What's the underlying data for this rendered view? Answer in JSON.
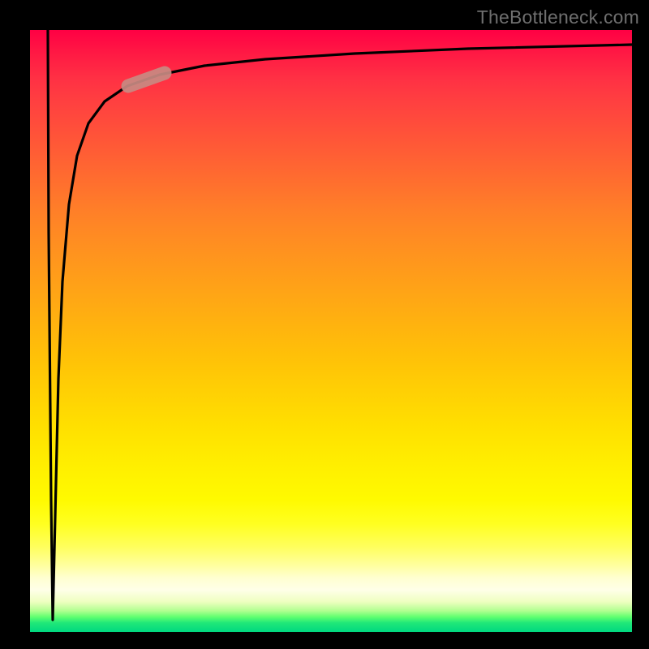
{
  "watermark": "TheBottleneck.com",
  "colors": {
    "curve": "#000000",
    "marker": "#c88a82",
    "gradient_top": "#ff0044",
    "gradient_mid": "#ffff20",
    "gradient_bottom": "#00d880",
    "frame": "#000000"
  },
  "chart_data": {
    "type": "line",
    "title": "",
    "xlabel": "",
    "ylabel": "",
    "xlim": [
      0,
      100
    ],
    "ylim": [
      0,
      100
    ],
    "legend_position": "none",
    "grid": false,
    "annotations": [
      {
        "text": "TheBottleneck.com",
        "position": "top-right"
      }
    ],
    "series": [
      {
        "name": "bottleneck-curve",
        "color": "#000000",
        "points": [
          {
            "x": 3.0,
            "y": 100.0
          },
          {
            "x": 3.2,
            "y": 50.0
          },
          {
            "x": 3.8,
            "y": 2.0
          },
          {
            "x": 4.2,
            "y": 20.0
          },
          {
            "x": 4.8,
            "y": 45.0
          },
          {
            "x": 5.5,
            "y": 60.0
          },
          {
            "x": 6.5,
            "y": 72.0
          },
          {
            "x": 8.0,
            "y": 80.0
          },
          {
            "x": 10.0,
            "y": 85.0
          },
          {
            "x": 13.0,
            "y": 88.5
          },
          {
            "x": 17.0,
            "y": 91.0
          },
          {
            "x": 22.0,
            "y": 92.7
          },
          {
            "x": 30.0,
            "y": 94.0
          },
          {
            "x": 40.0,
            "y": 95.0
          },
          {
            "x": 55.0,
            "y": 96.0
          },
          {
            "x": 75.0,
            "y": 97.0
          },
          {
            "x": 100.0,
            "y": 97.6
          }
        ]
      }
    ],
    "marker": {
      "name": "highlight-segment",
      "color": "#c88a82",
      "x_range": [
        16.3,
        22.5
      ],
      "y_range": [
        90.5,
        93.0
      ]
    }
  }
}
